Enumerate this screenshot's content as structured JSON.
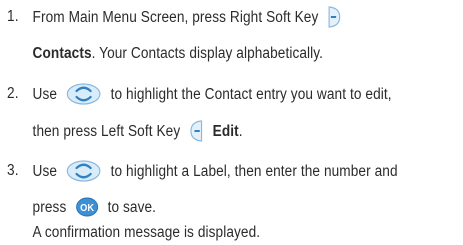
{
  "steps": [
    {
      "number": "1.",
      "line1_pre": "From Main Menu Screen, press Right Soft Key",
      "line2_bold": "Contacts",
      "line2_post": ". Your Contacts display alphabetically."
    },
    {
      "number": "2.",
      "line1_pre": "Use",
      "line1_post": "to highlight the Contact entry you want to edit,",
      "line2_pre": "then press Left Soft Key",
      "line2_bold": "Edit",
      "line2_post": "."
    },
    {
      "number": "3.",
      "line1_pre": "Use",
      "line1_post": "to highlight a Label, then enter the number and",
      "line2_pre": "press",
      "line2_post": "to save.",
      "ok_key_label": "OK"
    }
  ],
  "note": "A confirmation message is displayed.",
  "icons": {
    "right_soft_key": "right-soft-key-icon",
    "left_soft_key": "left-soft-key-icon",
    "nav_key": "navigation-key-icon",
    "ok_key": "ok-key-icon"
  },
  "colors": {
    "key_fill": "#cfe6f6",
    "key_stroke": "#6fa9d1",
    "key_dark": "#2f80c4",
    "ok_fill": "#3d8fd6"
  }
}
